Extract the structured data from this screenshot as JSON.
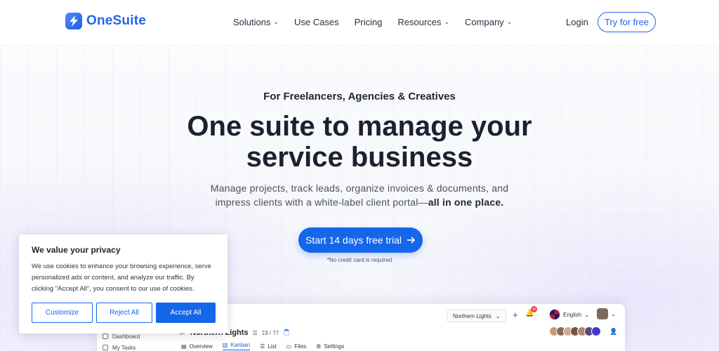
{
  "brand": {
    "name": "OneSuite",
    "logo_icon": "lightning-bolt-icon",
    "accent": "#1466ea"
  },
  "nav": {
    "items": [
      {
        "label": "Solutions",
        "dropdown": true
      },
      {
        "label": "Use Cases",
        "dropdown": false
      },
      {
        "label": "Pricing",
        "dropdown": false
      },
      {
        "label": "Resources",
        "dropdown": true
      },
      {
        "label": "Company",
        "dropdown": true
      }
    ],
    "login": "Login",
    "try": "Try for free"
  },
  "hero": {
    "kicker": "For Freelancers, Agencies & Creatives",
    "headline_line1": "One suite to manage your",
    "headline_line2": "service business",
    "sub_line1": "Manage projects, track leads, organize invoices & documents, and",
    "sub_line2_prefix": "impress clients with a white-label client portal—",
    "sub_line2_bold": "all in one place.",
    "cta": "Start 14 days free trial",
    "cta_note": "*No credit card is required"
  },
  "preview": {
    "sidebar": [
      "Dashboard",
      "My Tasks"
    ],
    "project_title": "Northern Lights",
    "project_count": "19 / 77",
    "tabs": [
      {
        "label": "Overview",
        "icon": "overview-icon",
        "active": false
      },
      {
        "label": "Kanban",
        "icon": "kanban-icon",
        "active": true
      },
      {
        "label": "List",
        "icon": "list-icon",
        "active": false
      },
      {
        "label": "Files",
        "icon": "files-icon",
        "active": false
      },
      {
        "label": "Settings",
        "icon": "settings-icon",
        "active": false
      }
    ],
    "workspace": "Northern Lights",
    "notification_count": "10",
    "language": "English"
  },
  "cookie": {
    "title": "We value your privacy",
    "text": "We use cookies to enhance your browsing experience, serve personalized ads or content, and analyze our traffic. By clicking \"Accept All\", you consent to our use of cookies.",
    "customize": "Customize",
    "reject": "Reject All",
    "accept": "Accept All"
  }
}
